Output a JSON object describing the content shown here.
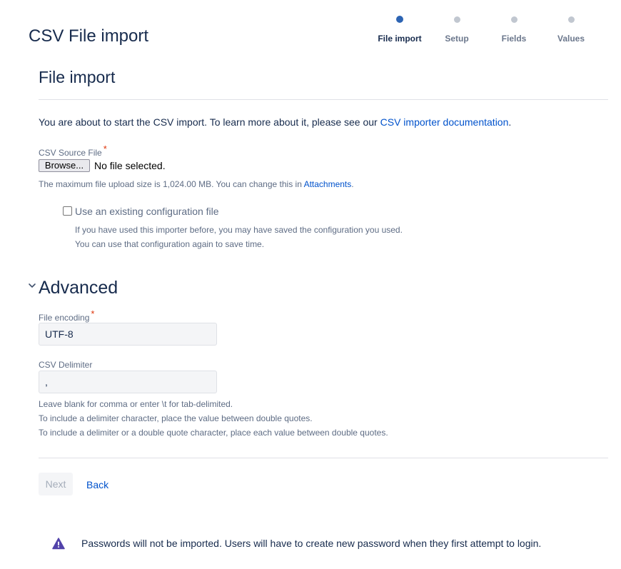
{
  "header": {
    "title": "CSV File import"
  },
  "steps": [
    {
      "label": "File import",
      "active": true
    },
    {
      "label": "Setup",
      "active": false
    },
    {
      "label": "Fields",
      "active": false
    },
    {
      "label": "Values",
      "active": false
    }
  ],
  "file_import": {
    "section_title": "File import",
    "intro_text": "You are about to start the CSV import. To learn more about it, please see our ",
    "intro_link": "CSV importer documentation",
    "intro_suffix": ".",
    "source_label": "CSV Source File",
    "required_mark": "*",
    "browse_label": "Browse...",
    "file_status": "No file selected.",
    "max_size_text": "The maximum file upload size is 1,024.00 MB. You can change this in ",
    "max_size_link": "Attachments",
    "max_size_suffix": ".",
    "config_checkbox_label": "Use an existing configuration file",
    "config_checked": false,
    "config_help_1": "If you have used this importer before, you may have saved the configuration you used.",
    "config_help_2": "You can use that configuration again to save time."
  },
  "advanced": {
    "title": "Advanced",
    "encoding_label": "File encoding",
    "encoding_value": "UTF-8",
    "delimiter_label": "CSV Delimiter",
    "delimiter_value": ",",
    "help_1": "Leave blank for comma or enter \\t for tab-delimited.",
    "help_2": "To include a delimiter character, place the value between double quotes.",
    "help_3": "To include a delimiter or a double quote character, place each value between double quotes."
  },
  "actions": {
    "next_label": "Next",
    "back_label": "Back"
  },
  "warning": {
    "text": "Passwords will not be imported. Users will have to create new password when they first attempt to login."
  },
  "colors": {
    "link": "#0052cc",
    "active_step": "#2d64b3",
    "warning_icon": "#5243aa",
    "required": "#de350b"
  }
}
